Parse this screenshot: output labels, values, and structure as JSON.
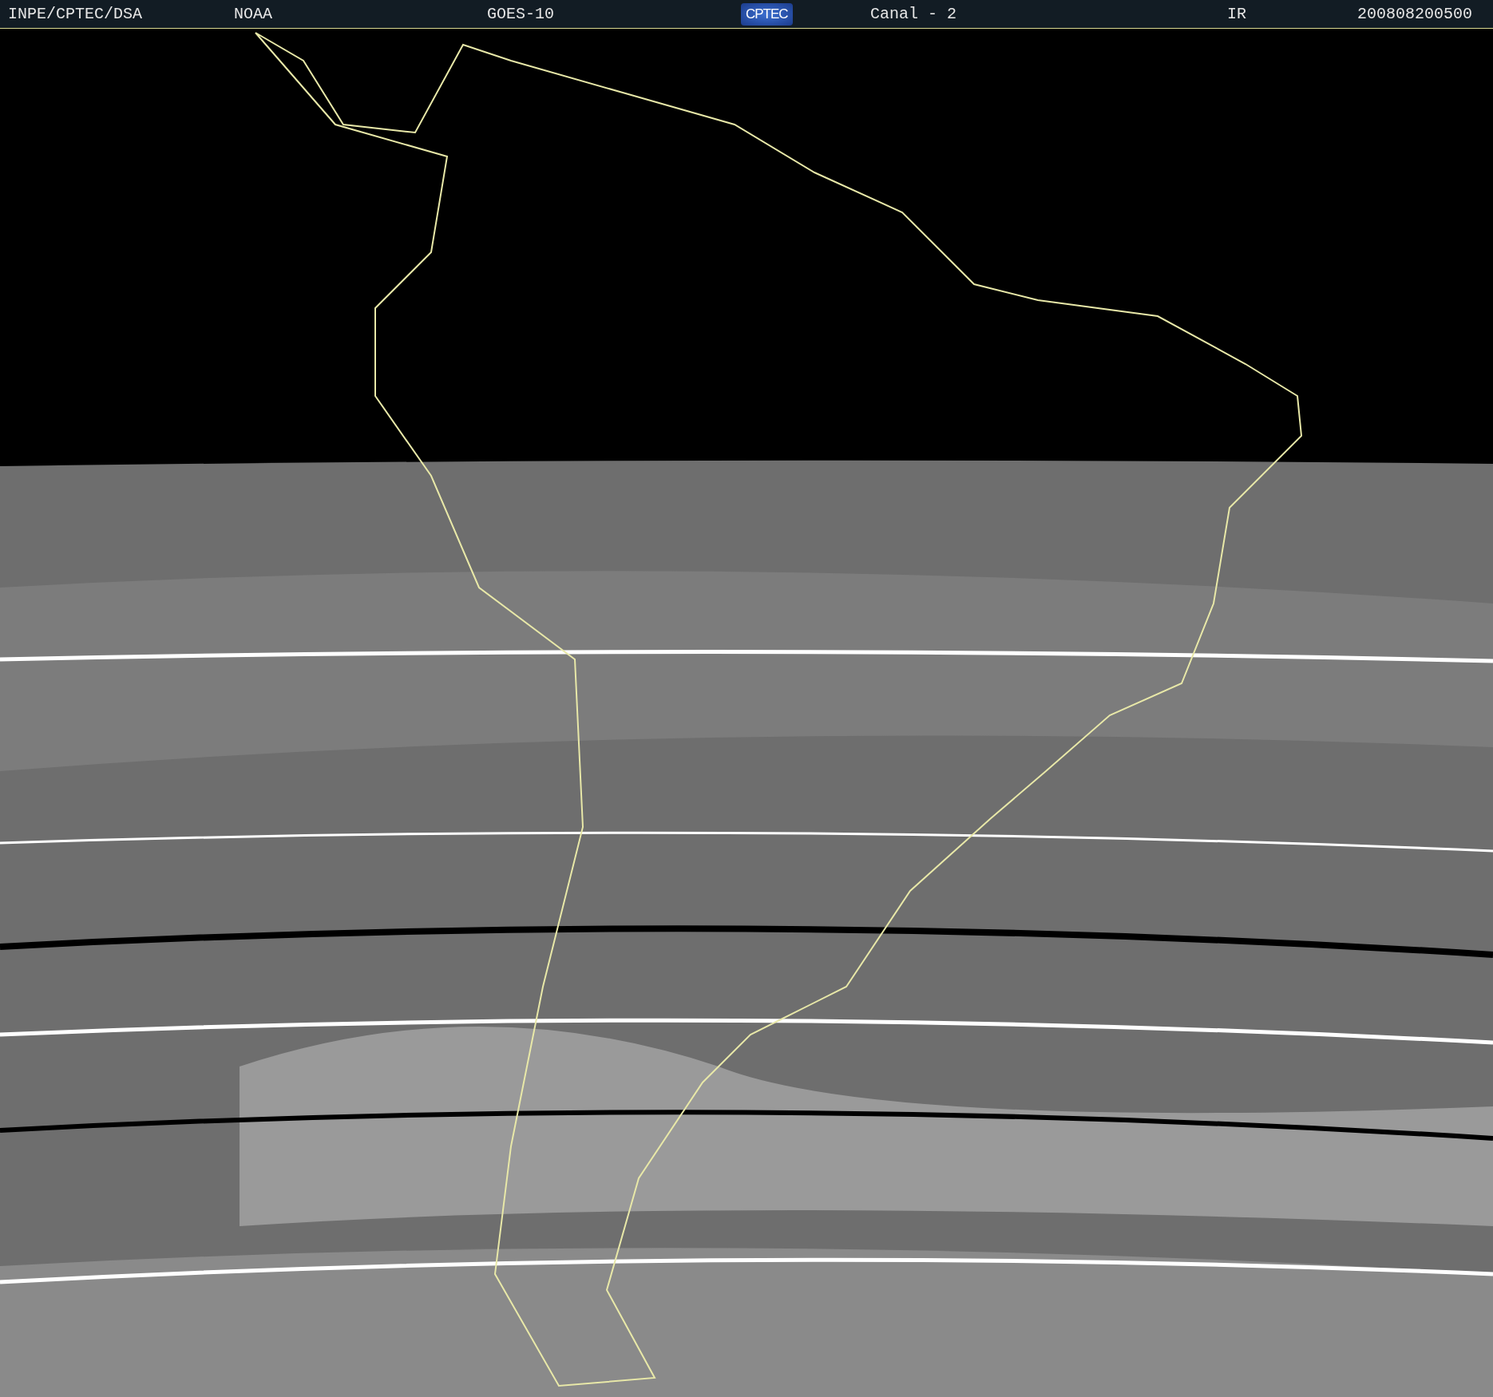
{
  "header": {
    "items": [
      {
        "kind": "text",
        "text": "INPE/CPTEC/DSA"
      },
      {
        "kind": "text",
        "text": "NOAA"
      },
      {
        "kind": "text",
        "text": "GOES-10"
      },
      {
        "kind": "logo",
        "text": "CPTEC"
      },
      {
        "kind": "text",
        "text": "Canal - 2"
      },
      {
        "kind": "text",
        "text": "IR"
      },
      {
        "kind": "text",
        "text": "200808200500"
      }
    ]
  }
}
